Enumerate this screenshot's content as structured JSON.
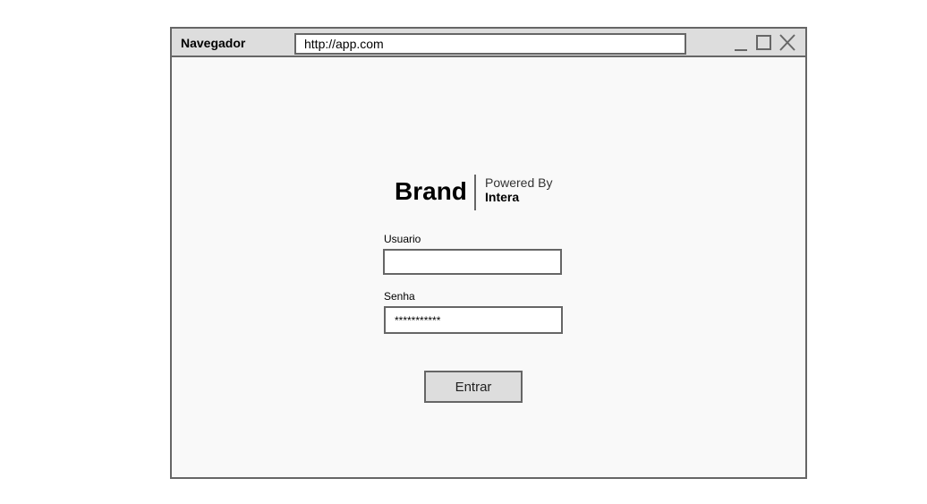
{
  "window": {
    "title": "Navegador",
    "url": "http://app.com",
    "controls": {
      "minimize_icon": "minimize-icon",
      "maximize_icon": "maximize-icon",
      "close_icon": "close-icon"
    }
  },
  "login": {
    "brand_name": "Brand",
    "powered_by_label": "Powered By",
    "powered_by_company": "Intera",
    "username_label": "Usuario",
    "username_value": "",
    "password_label": "Senha",
    "password_value": "***********",
    "submit_label": "Entrar"
  },
  "colors": {
    "border": "#666666",
    "titlebar_bg": "#dddddd",
    "content_bg": "#f9f9f9",
    "button_bg": "#dddddd"
  }
}
